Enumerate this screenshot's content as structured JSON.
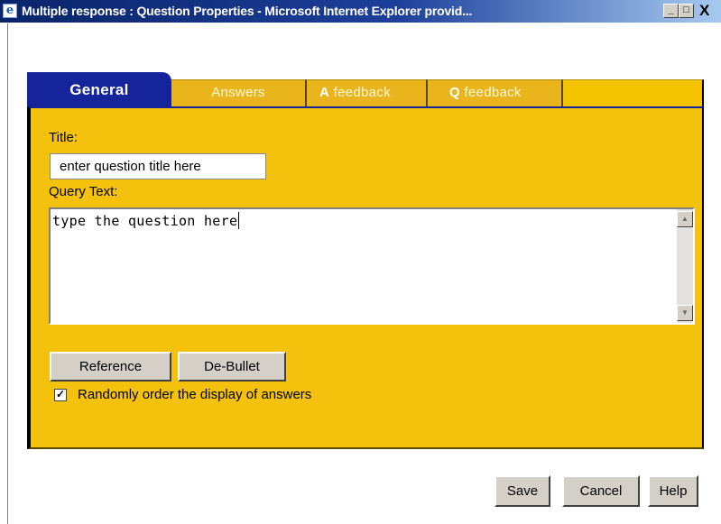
{
  "window": {
    "title": "Multiple response : Question Properties - Microsoft Internet Explorer provid...",
    "icon": "ie-page-icon",
    "controls": {
      "minimize": "_",
      "maximize": "□",
      "close": "X"
    }
  },
  "tabs": [
    {
      "label": "General",
      "active": true
    },
    {
      "label": "Answers",
      "active": false
    },
    {
      "prefix": "A",
      "label": " feedback",
      "active": false
    },
    {
      "prefix": "Q",
      "label": " feedback",
      "active": false
    }
  ],
  "form": {
    "title_label": "Title:",
    "title_value": "enter question title here",
    "query_label": "Query Text:",
    "query_value": "type the question here",
    "reference_button": "Reference",
    "debullet_button": "De-Bullet",
    "random_order": {
      "checked": true,
      "label": "Randomly order the display of answers"
    }
  },
  "footer": {
    "save": "Save",
    "cancel": "Cancel",
    "help": "Help"
  },
  "colors": {
    "panel": "#f4c20d",
    "active_tab": "#16249b",
    "inactive_tab": "#eab51c"
  }
}
